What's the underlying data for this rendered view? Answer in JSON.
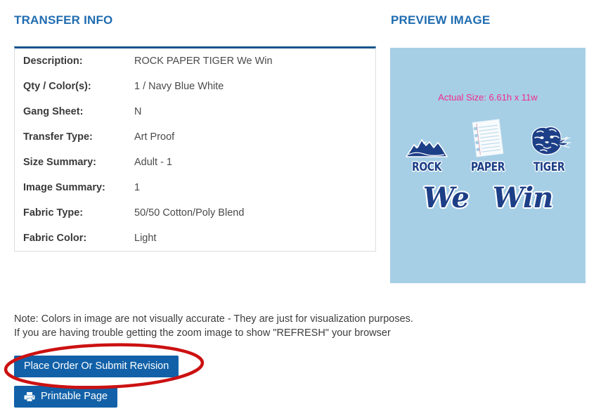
{
  "transfer_info": {
    "heading": "TRANSFER INFO",
    "rows": [
      {
        "label": "Description:",
        "value": "ROCK PAPER TIGER We Win"
      },
      {
        "label": "Qty / Color(s):",
        "value": "1 / Navy Blue White"
      },
      {
        "label": "Gang Sheet:",
        "value": "N"
      },
      {
        "label": "Transfer Type:",
        "value": "Art Proof"
      },
      {
        "label": "Size Summary:",
        "value": "Adult - 1"
      },
      {
        "label": "Image Summary:",
        "value": "1"
      },
      {
        "label": "Fabric Type:",
        "value": "50/50 Cotton/Poly Blend"
      },
      {
        "label": "Fabric Color:",
        "value": "Light"
      }
    ]
  },
  "preview": {
    "heading": "PREVIEW IMAGE",
    "actual_size_text": "Actual Size: 6.61h x 11w",
    "background_color": "#a6cfe6",
    "artwork_color": "#1d3f87",
    "actual_size_color": "#ee2c8c",
    "icons": [
      {
        "word": "ROCK",
        "icon": "mountain-icon"
      },
      {
        "word": "PAPER",
        "icon": "notebook-paper-icon"
      },
      {
        "word": "TIGER",
        "icon": "tiger-head-icon"
      }
    ],
    "script_words": [
      "We",
      "Win"
    ]
  },
  "note": {
    "line1": "Note: Colors in image are not visually accurate - They are just for visualization purposes.",
    "line2": "If you are having trouble getting the zoom image to show \"REFRESH\" your browser"
  },
  "buttons": {
    "place_order": "Place Order Or Submit Revision",
    "printable_page": "Printable Page",
    "color": "#1261a8"
  },
  "annotation": {
    "shape": "ellipse",
    "color": "#cc1111",
    "target": "place-order-button"
  }
}
